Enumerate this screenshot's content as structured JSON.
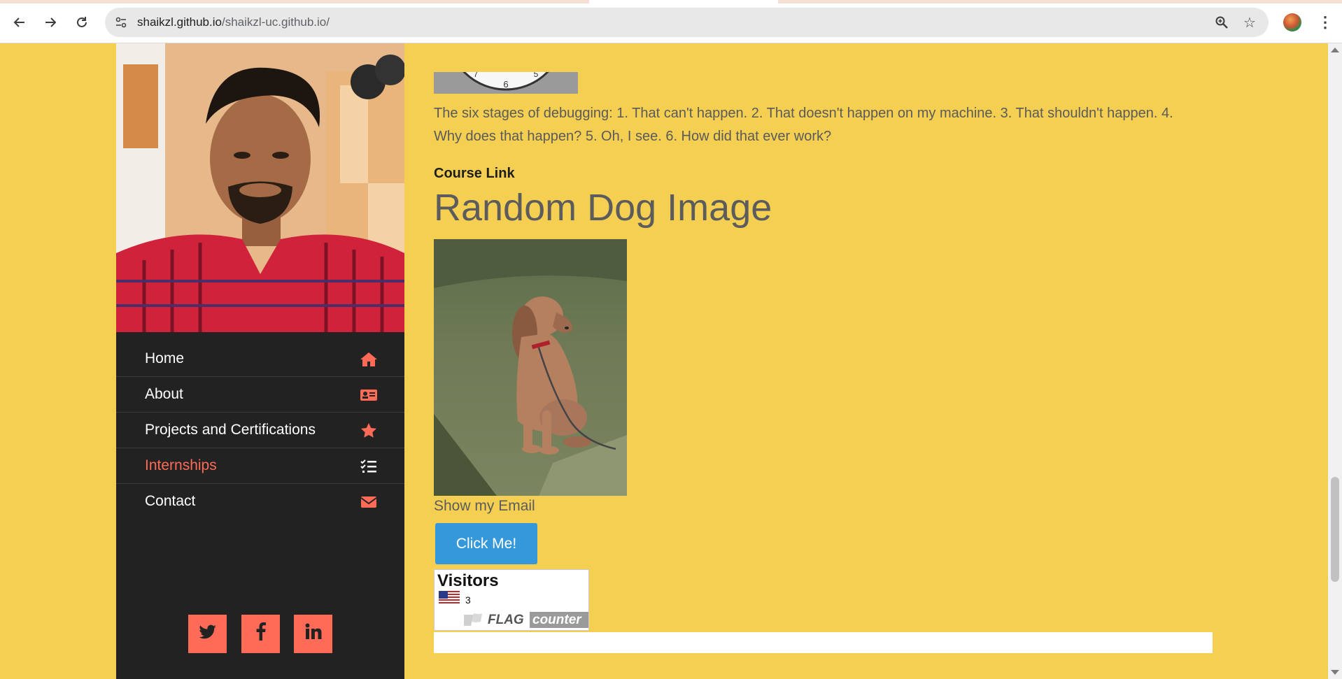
{
  "browser": {
    "url_host": "shaikzl.github.io",
    "url_path": "/shaikzl-uc.github.io/"
  },
  "sidebar": {
    "nav_items": [
      {
        "label": "Home",
        "icon": "home-icon"
      },
      {
        "label": "About",
        "icon": "id-card-icon"
      },
      {
        "label": "Projects and Certifications",
        "icon": "star-icon"
      },
      {
        "label": "Internships",
        "icon": "tasks-icon",
        "active": true
      },
      {
        "label": "Contact",
        "icon": "envelope-icon"
      }
    ],
    "social": [
      {
        "icon": "twitter-icon"
      },
      {
        "icon": "facebook-icon"
      },
      {
        "icon": "linkedin-icon"
      }
    ]
  },
  "main": {
    "clock_digits": [
      "6",
      "5",
      "7"
    ],
    "quote": "The six stages of debugging: 1. That can't happen. 2. That doesn't happen on my machine. 3. That shouldn't happen. 4. Why does that happen? 5. Oh, I see. 6. How did that ever work?",
    "course_link": "Course Link",
    "dog_title": "Random Dog Image",
    "show_email": "Show my Email",
    "click_button": "Click Me!",
    "visitors": {
      "title": "Visitors",
      "count": "3",
      "logo_text_1": "FLAG",
      "logo_text_2": "counter"
    }
  },
  "colors": {
    "page_bg": "#f5cf52",
    "sidebar_bg": "#222222",
    "accent": "#ff6b57",
    "button_blue": "#3498db"
  }
}
